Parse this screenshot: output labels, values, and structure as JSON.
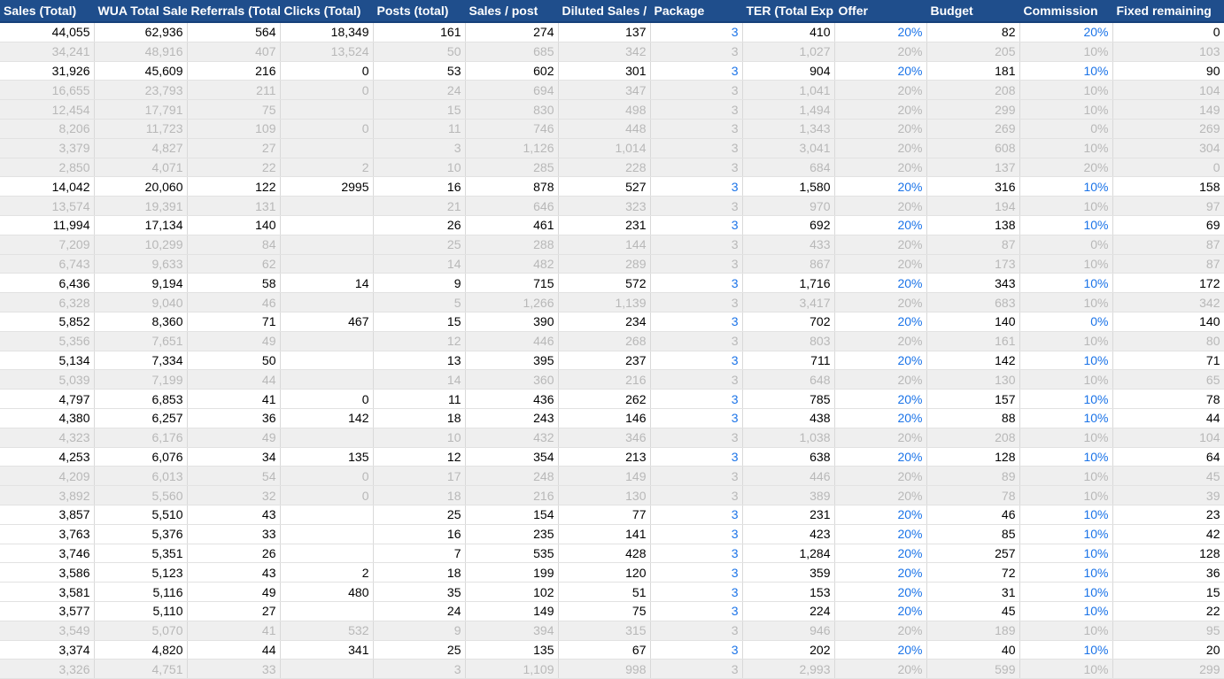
{
  "columns": [
    "Sales (Total)",
    "WUA Total Sale",
    "Referrals (Total",
    "Clicks (Total)",
    "Posts (total)",
    "Sales / post",
    "Diluted Sales / p",
    "Package",
    "TER (Total Exp",
    "Offer",
    "Budget",
    "Commission",
    "Fixed remaining"
  ],
  "rows": [
    {
      "dim": false,
      "cells": [
        "44,055",
        "62,936",
        "564",
        "18,349",
        "161",
        "274",
        "137",
        "3",
        "410",
        "20%",
        "82",
        "20%",
        "0"
      ]
    },
    {
      "dim": true,
      "cells": [
        "34,241",
        "48,916",
        "407",
        "13,524",
        "50",
        "685",
        "342",
        "3",
        "1,027",
        "20%",
        "205",
        "10%",
        "103"
      ]
    },
    {
      "dim": false,
      "cells": [
        "31,926",
        "45,609",
        "216",
        "0",
        "53",
        "602",
        "301",
        "3",
        "904",
        "20%",
        "181",
        "10%",
        "90"
      ]
    },
    {
      "dim": true,
      "cells": [
        "16,655",
        "23,793",
        "211",
        "0",
        "24",
        "694",
        "347",
        "3",
        "1,041",
        "20%",
        "208",
        "10%",
        "104"
      ]
    },
    {
      "dim": true,
      "cells": [
        "12,454",
        "17,791",
        "75",
        "",
        "15",
        "830",
        "498",
        "3",
        "1,494",
        "20%",
        "299",
        "10%",
        "149"
      ]
    },
    {
      "dim": true,
      "cells": [
        "8,206",
        "11,723",
        "109",
        "0",
        "11",
        "746",
        "448",
        "3",
        "1,343",
        "20%",
        "269",
        "0%",
        "269"
      ]
    },
    {
      "dim": true,
      "cells": [
        "3,379",
        "4,827",
        "27",
        "",
        "3",
        "1,126",
        "1,014",
        "3",
        "3,041",
        "20%",
        "608",
        "10%",
        "304"
      ]
    },
    {
      "dim": true,
      "cells": [
        "2,850",
        "4,071",
        "22",
        "2",
        "10",
        "285",
        "228",
        "3",
        "684",
        "20%",
        "137",
        "20%",
        "0"
      ]
    },
    {
      "dim": false,
      "cells": [
        "14,042",
        "20,060",
        "122",
        "2995",
        "16",
        "878",
        "527",
        "3",
        "1,580",
        "20%",
        "316",
        "10%",
        "158"
      ]
    },
    {
      "dim": true,
      "cells": [
        "13,574",
        "19,391",
        "131",
        "",
        "21",
        "646",
        "323",
        "3",
        "970",
        "20%",
        "194",
        "10%",
        "97"
      ]
    },
    {
      "dim": false,
      "cells": [
        "11,994",
        "17,134",
        "140",
        "",
        "26",
        "461",
        "231",
        "3",
        "692",
        "20%",
        "138",
        "10%",
        "69"
      ]
    },
    {
      "dim": true,
      "cells": [
        "7,209",
        "10,299",
        "84",
        "",
        "25",
        "288",
        "144",
        "3",
        "433",
        "20%",
        "87",
        "0%",
        "87"
      ]
    },
    {
      "dim": true,
      "cells": [
        "6,743",
        "9,633",
        "62",
        "",
        "14",
        "482",
        "289",
        "3",
        "867",
        "20%",
        "173",
        "10%",
        "87"
      ]
    },
    {
      "dim": false,
      "cells": [
        "6,436",
        "9,194",
        "58",
        "14",
        "9",
        "715",
        "572",
        "3",
        "1,716",
        "20%",
        "343",
        "10%",
        "172"
      ]
    },
    {
      "dim": true,
      "cells": [
        "6,328",
        "9,040",
        "46",
        "",
        "5",
        "1,266",
        "1,139",
        "3",
        "3,417",
        "20%",
        "683",
        "10%",
        "342"
      ]
    },
    {
      "dim": false,
      "cells": [
        "5,852",
        "8,360",
        "71",
        "467",
        "15",
        "390",
        "234",
        "3",
        "702",
        "20%",
        "140",
        "0%",
        "140"
      ]
    },
    {
      "dim": true,
      "cells": [
        "5,356",
        "7,651",
        "49",
        "",
        "12",
        "446",
        "268",
        "3",
        "803",
        "20%",
        "161",
        "10%",
        "80"
      ]
    },
    {
      "dim": false,
      "cells": [
        "5,134",
        "7,334",
        "50",
        "",
        "13",
        "395",
        "237",
        "3",
        "711",
        "20%",
        "142",
        "10%",
        "71"
      ]
    },
    {
      "dim": true,
      "cells": [
        "5,039",
        "7,199",
        "44",
        "",
        "14",
        "360",
        "216",
        "3",
        "648",
        "20%",
        "130",
        "10%",
        "65"
      ]
    },
    {
      "dim": false,
      "cells": [
        "4,797",
        "6,853",
        "41",
        "0",
        "11",
        "436",
        "262",
        "3",
        "785",
        "20%",
        "157",
        "10%",
        "78"
      ]
    },
    {
      "dim": false,
      "cells": [
        "4,380",
        "6,257",
        "36",
        "142",
        "18",
        "243",
        "146",
        "3",
        "438",
        "20%",
        "88",
        "10%",
        "44"
      ]
    },
    {
      "dim": true,
      "cells": [
        "4,323",
        "6,176",
        "49",
        "",
        "10",
        "432",
        "346",
        "3",
        "1,038",
        "20%",
        "208",
        "10%",
        "104"
      ]
    },
    {
      "dim": false,
      "cells": [
        "4,253",
        "6,076",
        "34",
        "135",
        "12",
        "354",
        "213",
        "3",
        "638",
        "20%",
        "128",
        "10%",
        "64"
      ]
    },
    {
      "dim": true,
      "cells": [
        "4,209",
        "6,013",
        "54",
        "0",
        "17",
        "248",
        "149",
        "3",
        "446",
        "20%",
        "89",
        "10%",
        "45"
      ]
    },
    {
      "dim": true,
      "cells": [
        "3,892",
        "5,560",
        "32",
        "0",
        "18",
        "216",
        "130",
        "3",
        "389",
        "20%",
        "78",
        "10%",
        "39"
      ]
    },
    {
      "dim": false,
      "cells": [
        "3,857",
        "5,510",
        "43",
        "",
        "25",
        "154",
        "77",
        "3",
        "231",
        "20%",
        "46",
        "10%",
        "23"
      ]
    },
    {
      "dim": false,
      "cells": [
        "3,763",
        "5,376",
        "33",
        "",
        "16",
        "235",
        "141",
        "3",
        "423",
        "20%",
        "85",
        "10%",
        "42"
      ]
    },
    {
      "dim": false,
      "cells": [
        "3,746",
        "5,351",
        "26",
        "",
        "7",
        "535",
        "428",
        "3",
        "1,284",
        "20%",
        "257",
        "10%",
        "128"
      ]
    },
    {
      "dim": false,
      "cells": [
        "3,586",
        "5,123",
        "43",
        "2",
        "18",
        "199",
        "120",
        "3",
        "359",
        "20%",
        "72",
        "10%",
        "36"
      ]
    },
    {
      "dim": false,
      "cells": [
        "3,581",
        "5,116",
        "49",
        "480",
        "35",
        "102",
        "51",
        "3",
        "153",
        "20%",
        "31",
        "10%",
        "15"
      ]
    },
    {
      "dim": false,
      "cells": [
        "3,577",
        "5,110",
        "27",
        "",
        "24",
        "149",
        "75",
        "3",
        "224",
        "20%",
        "45",
        "10%",
        "22"
      ]
    },
    {
      "dim": true,
      "cells": [
        "3,549",
        "5,070",
        "41",
        "532",
        "9",
        "394",
        "315",
        "3",
        "946",
        "20%",
        "189",
        "10%",
        "95"
      ]
    },
    {
      "dim": false,
      "cells": [
        "3,374",
        "4,820",
        "44",
        "341",
        "25",
        "135",
        "67",
        "3",
        "202",
        "20%",
        "40",
        "10%",
        "20"
      ]
    },
    {
      "dim": true,
      "cells": [
        "3,326",
        "4,751",
        "33",
        "",
        "3",
        "1,109",
        "998",
        "3",
        "2,993",
        "20%",
        "599",
        "10%",
        "299"
      ]
    }
  ],
  "colors": {
    "header_bg": "#1f4e8c",
    "link_blue": "#1a73e8",
    "dim_row_bg": "#efefef",
    "dim_text": "#b8b8b8"
  }
}
